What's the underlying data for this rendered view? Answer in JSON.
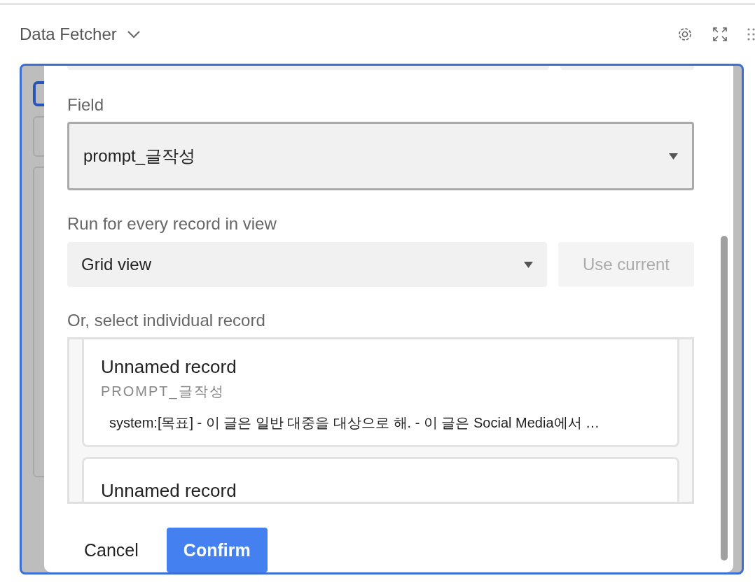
{
  "header": {
    "title": "Data Fetcher"
  },
  "dialog": {
    "field": {
      "label": "Field",
      "value": "prompt_글작성",
      "focused": true
    },
    "view": {
      "label": "Run for every record in view",
      "value": "Grid view",
      "use_current": {
        "label": "Use current",
        "disabled": true
      }
    },
    "records": {
      "label": "Or, select individual record",
      "items": [
        {
          "title": "Unnamed record",
          "field_name": "PROMPT_글작성",
          "preview": "system:[목표] - 이 글은 일반 대중을 대상으로 해. - 이 글은 Social Media에서 …"
        },
        {
          "title": "Unnamed record"
        }
      ]
    },
    "buttons": [
      {
        "label": "Cancel",
        "kind": "secondary"
      },
      {
        "label": "Confirm",
        "kind": "primary"
      }
    ]
  }
}
